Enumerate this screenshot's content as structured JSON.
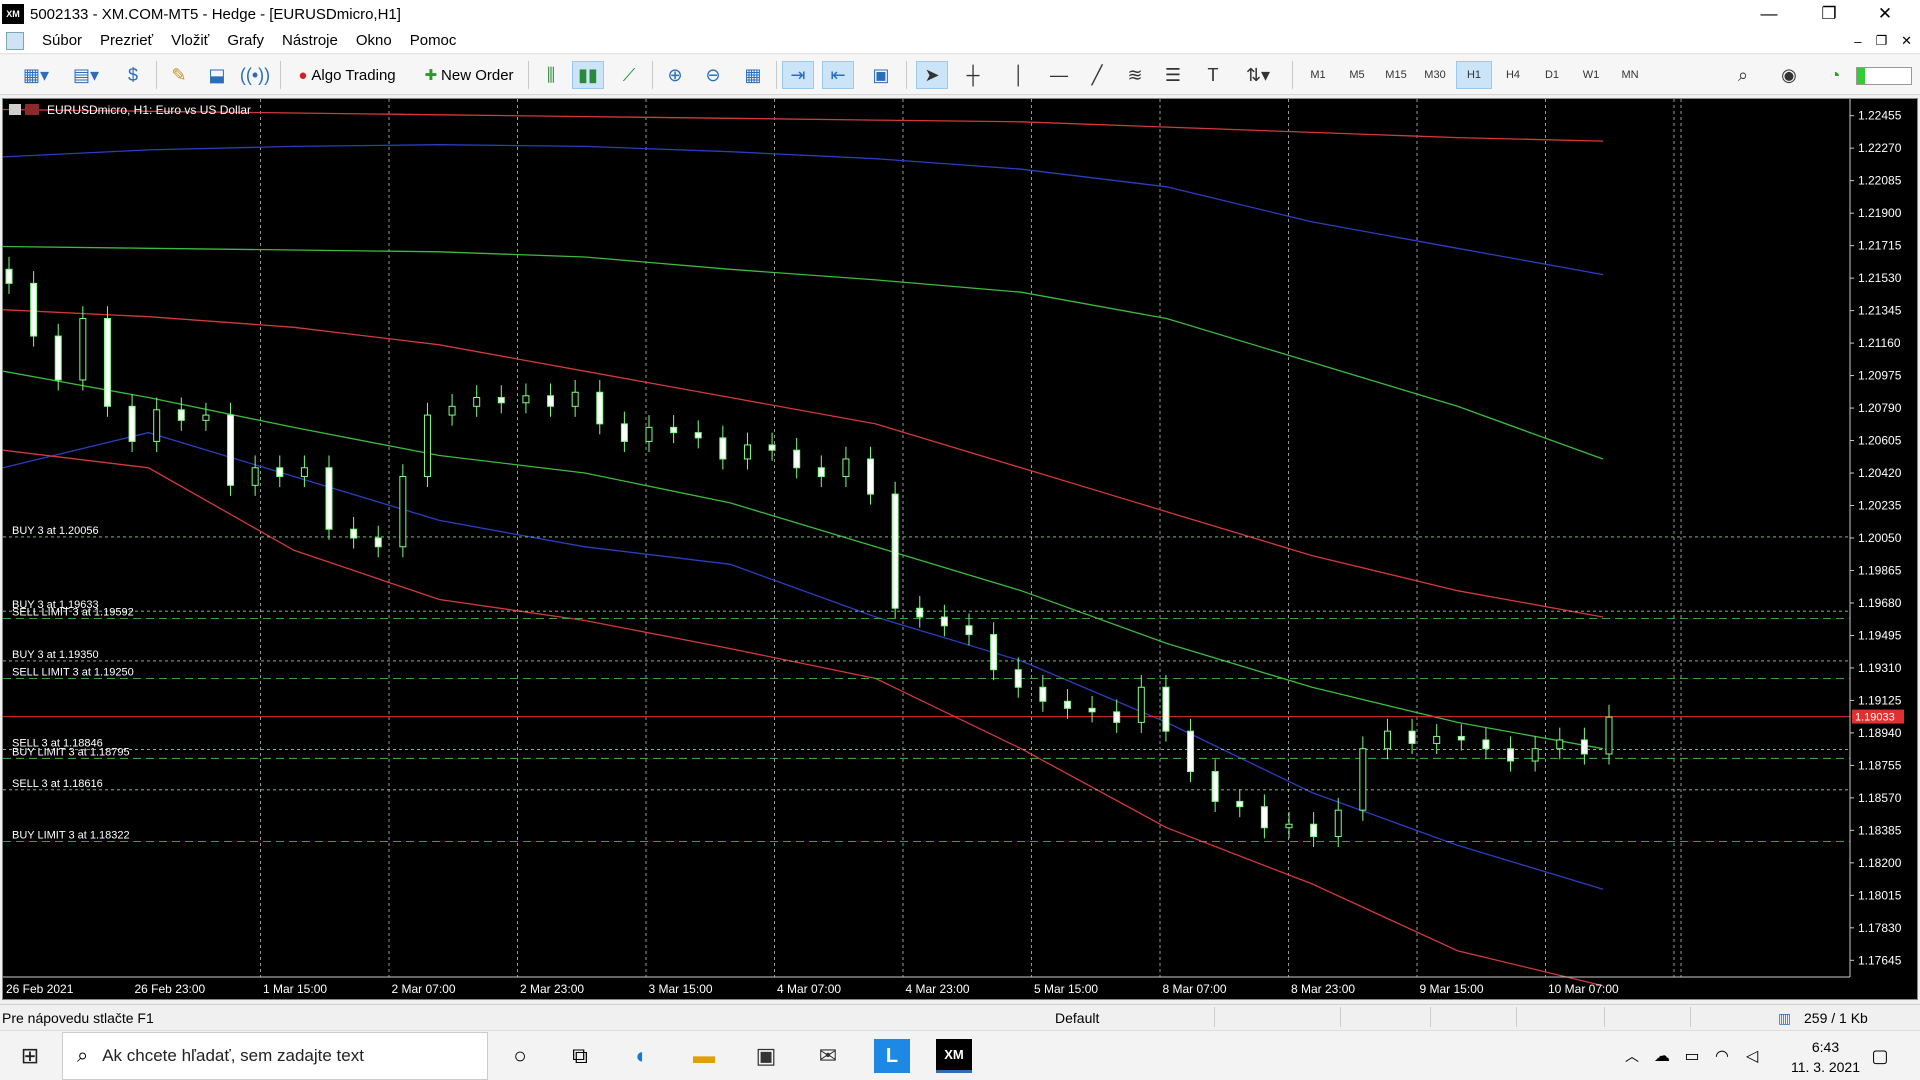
{
  "window": {
    "app_icon_text": "XM",
    "title": "5002133 - XM.COM-MT5 - Hedge - [EURUSDmicro,H1]",
    "minimize": "—",
    "maximize": "❐",
    "close": "✕"
  },
  "menu": {
    "items": [
      "Súbor",
      "Prezrieť",
      "Vložiť",
      "Grafy",
      "Nástroje",
      "Okno",
      "Pomoc"
    ],
    "mdi_controls": [
      "–",
      "❐",
      "✕"
    ]
  },
  "toolbar": {
    "algo_trading": "Algo Trading",
    "new_order": "New Order",
    "timeframes": [
      "M1",
      "M5",
      "M15",
      "M30",
      "H1",
      "H4",
      "D1",
      "W1",
      "MN"
    ],
    "active_timeframe": "H1",
    "icons": [
      "new-chart-icon",
      "profiles-icon",
      "market-watch-icon",
      "data-window-icon",
      "navigator-icon",
      "signals-icon",
      "algo-trading-icon",
      "new-order-icon",
      "bar-chart-icon",
      "candlestick-icon",
      "line-chart-icon",
      "zoom-in-icon",
      "zoom-out-icon",
      "tile-icon",
      "autoscroll-icon",
      "chart-shift-icon",
      "templates-icon",
      "cursor-icon",
      "crosshair-icon",
      "vertical-line-icon",
      "horizontal-line-icon",
      "trendline-icon",
      "fibonacci-icon",
      "channel-icon",
      "text-icon",
      "arrows-icon",
      "search-icon",
      "account-icon",
      "signal-strength-icon"
    ]
  },
  "chart": {
    "symbol_label": "EURUSDmicro, H1:  Euro vs US Dollar",
    "price_labels": [
      "1.22455",
      "1.22270",
      "1.22085",
      "1.21900",
      "1.21715",
      "1.21530",
      "1.21345",
      "1.21160",
      "1.20975",
      "1.20790",
      "1.20605",
      "1.20420",
      "1.20235",
      "1.20050",
      "1.19865",
      "1.19680",
      "1.19495",
      "1.19310",
      "1.19125",
      "1.18940",
      "1.18755",
      "1.18570",
      "1.18385",
      "1.18200",
      "1.18015",
      "1.17830",
      "1.17645"
    ],
    "time_labels": [
      "26 Feb 2021",
      "26 Feb 23:00",
      "1 Mar 15:00",
      "2 Mar 07:00",
      "2 Mar 23:00",
      "3 Mar 15:00",
      "4 Mar 07:00",
      "4 Mar 23:00",
      "5 Mar 15:00",
      "8 Mar 07:00",
      "8 Mar 23:00",
      "9 Mar 15:00",
      "10 Mar 07:00"
    ],
    "current_price": "1.19033",
    "order_labels": [
      "BUY 3 at 1.20056",
      "BUY 3 at 1.19633",
      "SELL LIMIT 3 at 1.19592",
      "BUY 3 at 1.19350",
      "SELL LIMIT 3 at 1.19250",
      "SELL 3 at 1.18846",
      "BUY LIMIT 3 at 1.18795",
      "SELL 3 at 1.18616",
      "BUY LIMIT 3 at 1.18322"
    ]
  },
  "chart_data": {
    "type": "candlestick",
    "symbol": "EURUSDmicro",
    "timeframe": "H1",
    "ylim": [
      1.1755,
      1.2255
    ],
    "current_price": 1.19033,
    "x_ticks": [
      "26 Feb 2021",
      "26 Feb 23:00",
      "1 Mar 15:00",
      "2 Mar 07:00",
      "2 Mar 23:00",
      "3 Mar 15:00",
      "4 Mar 07:00",
      "4 Mar 23:00",
      "5 Mar 15:00",
      "8 Mar 07:00",
      "8 Mar 23:00",
      "9 Mar 15:00",
      "10 Mar 07:00"
    ],
    "closes": [
      1.215,
      1.212,
      1.2095,
      1.213,
      1.208,
      1.206,
      1.2078,
      1.2072,
      1.2075,
      1.2035,
      1.2045,
      1.204,
      1.2045,
      1.201,
      1.2005,
      1.2,
      1.204,
      1.2075,
      1.208,
      1.2085,
      1.2082,
      1.2086,
      1.208,
      1.2088,
      1.207,
      1.206,
      1.2068,
      1.2065,
      1.2062,
      1.205,
      1.2058,
      1.2055,
      1.2045,
      1.204,
      1.205,
      1.203,
      1.1965,
      1.196,
      1.1955,
      1.195,
      1.193,
      1.192,
      1.1912,
      1.1908,
      1.1906,
      1.19,
      1.192,
      1.1895,
      1.1872,
      1.1855,
      1.1852,
      1.184,
      1.1842,
      1.1835,
      1.185,
      1.1885,
      1.1895,
      1.1888,
      1.1892,
      1.189,
      1.1885,
      1.1878,
      1.1885,
      1.189,
      1.1882,
      1.1903
    ],
    "indicators": [
      {
        "name": "upper-envelope",
        "color": "#d23a3a",
        "values": [
          1.2249,
          1.2248,
          1.2247,
          1.2246,
          1.2245,
          1.2244,
          1.2243,
          1.2242,
          1.2239,
          1.2236,
          1.2233,
          1.2231
        ]
      },
      {
        "name": "upper-band",
        "color": "#2a3fbf",
        "values": [
          1.2222,
          1.2226,
          1.2228,
          1.2229,
          1.2228,
          1.2225,
          1.2221,
          1.2215,
          1.2205,
          1.2185,
          1.217,
          1.2155
        ]
      },
      {
        "name": "upper-ma",
        "color": "#3dba3d",
        "values": [
          1.2171,
          1.217,
          1.2169,
          1.2168,
          1.2165,
          1.2158,
          1.2152,
          1.2145,
          1.213,
          1.2105,
          1.208,
          1.205
        ]
      },
      {
        "name": "mid-envelope",
        "color": "#d23a3a",
        "values": [
          1.2135,
          1.2131,
          1.2125,
          1.2115,
          1.21,
          1.2085,
          1.207,
          1.2045,
          1.202,
          1.1995,
          1.1975,
          1.196
        ]
      },
      {
        "name": "middle-ma",
        "color": "#3dba3d",
        "values": [
          1.21,
          1.2085,
          1.2068,
          1.2052,
          1.2042,
          1.2025,
          1.2,
          1.1975,
          1.1945,
          1.192,
          1.19,
          1.1885
        ]
      },
      {
        "name": "lower-band",
        "color": "#2a3fbf",
        "values": [
          1.2045,
          1.2065,
          1.204,
          1.2015,
          1.2,
          1.199,
          1.196,
          1.1935,
          1.19,
          1.186,
          1.183,
          1.1805
        ]
      },
      {
        "name": "lower-envelope",
        "color": "#d23a3a",
        "values": [
          1.2055,
          1.2045,
          1.1998,
          1.197,
          1.1958,
          1.1942,
          1.1925,
          1.1885,
          1.184,
          1.1808,
          1.177,
          1.175
        ]
      }
    ],
    "order_levels": [
      1.20056,
      1.19633,
      1.19592,
      1.1935,
      1.1925,
      1.18846,
      1.18795,
      1.18616,
      1.18322
    ],
    "grid": true
  },
  "status": {
    "help": "Pre nápovedu stlačte F1",
    "profile": "Default",
    "traffic": "259 / 1 Kb"
  },
  "taskbar": {
    "search_placeholder": "Ak chcete hľadať, sem zadajte text",
    "time": "6:43",
    "date": "11. 3. 2021"
  }
}
